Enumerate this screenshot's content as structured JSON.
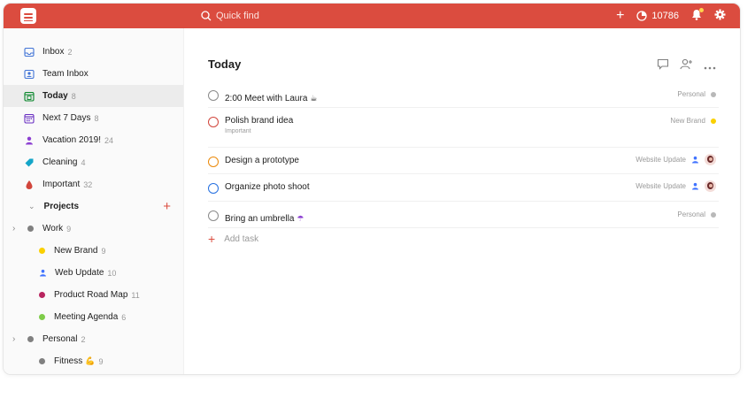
{
  "topbar": {
    "search_placeholder": "Quick find",
    "karma_value": "10786"
  },
  "sidebar": {
    "items": [
      {
        "label": "Inbox",
        "count": "2",
        "icon": "inbox-icon",
        "color": "#4073d6"
      },
      {
        "label": "Team Inbox",
        "count": "",
        "icon": "team-inbox-icon",
        "color": "#4073d6"
      },
      {
        "label": "Today",
        "count": "8",
        "icon": "today-calendar-icon",
        "color": "#058527"
      },
      {
        "label": "Next 7 Days",
        "count": "8",
        "icon": "next-7-days-calendar-icon",
        "color": "#692fc2"
      },
      {
        "label": "Vacation 2019!",
        "count": "24",
        "icon": "person-icon",
        "color": "#8c3fd1"
      },
      {
        "label": "Cleaning",
        "count": "4",
        "icon": "tag-icon",
        "color": "#14a5c8"
      },
      {
        "label": "Important",
        "count": "32",
        "icon": "drop-icon",
        "color": "#d1453b"
      }
    ],
    "projects_label": "Projects",
    "projects": [
      {
        "label": "Work",
        "count": "9",
        "color": "#808080",
        "level": "top"
      },
      {
        "label": "New Brand",
        "count": "9",
        "color": "#fad000",
        "level": "sub"
      },
      {
        "label": "Web Update",
        "count": "10",
        "color": "#4073ff",
        "level": "sub",
        "icon": "person-icon"
      },
      {
        "label": "Product Road Map",
        "count": "11",
        "color": "#b8255f",
        "level": "sub"
      },
      {
        "label": "Meeting Agenda",
        "count": "6",
        "color": "#7ecc49",
        "level": "sub"
      },
      {
        "label": "Personal",
        "count": "2",
        "color": "#808080",
        "level": "top"
      },
      {
        "label": "Fitness",
        "count": "9",
        "color": "#808080",
        "level": "sub",
        "emoji": "💪"
      }
    ]
  },
  "main": {
    "title": "Today",
    "add_task_label": "Add task",
    "tasks": [
      {
        "text": "2:00 Meet with Laura",
        "emoji": "☕",
        "project": "Personal",
        "check_color": "#8a8a8a",
        "dot_color": "#b8b8b8",
        "sub": ""
      },
      {
        "text": "Polish brand idea",
        "emoji": "",
        "project": "New Brand",
        "check_color": "#d1453b",
        "dot_color": "#fad000",
        "sub": "Important"
      },
      {
        "text": "Design a prototype",
        "emoji": "",
        "project": "Website Update",
        "check_color": "#eb8909",
        "dot_color": "",
        "sub": ""
      },
      {
        "text": "Organize photo shoot",
        "emoji": "",
        "project": "Website Update",
        "check_color": "#246fe0",
        "dot_color": "",
        "sub": ""
      },
      {
        "text": "Bring an umbrella",
        "emoji": "☂",
        "project": "Personal",
        "check_color": "#8a8a8a",
        "dot_color": "#b8b8b8",
        "sub": ""
      }
    ]
  }
}
